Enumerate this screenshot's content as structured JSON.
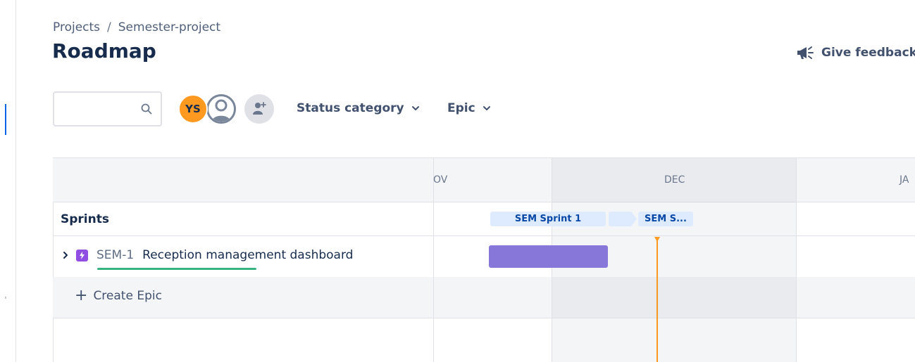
{
  "breadcrumb": {
    "projects": "Projects",
    "separator": "/",
    "project": "Semester-project"
  },
  "header": {
    "title": "Roadmap",
    "feedback_label": "Give feedback",
    "feedback_icon": "megaphone-icon"
  },
  "toolbar": {
    "search": {
      "value": "",
      "placeholder": "",
      "icon": "search-icon"
    },
    "avatars": [
      {
        "initials": "YS",
        "color": "#ff991f"
      },
      {
        "icon": "user-icon"
      },
      {
        "icon": "add-person-icon"
      }
    ],
    "filters": {
      "status_label": "Status category",
      "epic_label": "Epic"
    }
  },
  "timeline": {
    "months": [
      "OV",
      "DEC",
      "JA"
    ],
    "sprints_label": "Sprints",
    "sprints": [
      "SEM Sprint 1",
      "SEM S..."
    ],
    "today_color": "#ff991f"
  },
  "epics": [
    {
      "key": "SEM-1",
      "summary": "Reception management dashboard",
      "bar_color": "#8777d9"
    }
  ],
  "actions": {
    "create_epic": "Create Epic"
  },
  "colors": {
    "accent": "#0c66e4",
    "epic": "#904ee2",
    "sprint_bg": "#deebff",
    "underline": "#36b37e"
  }
}
